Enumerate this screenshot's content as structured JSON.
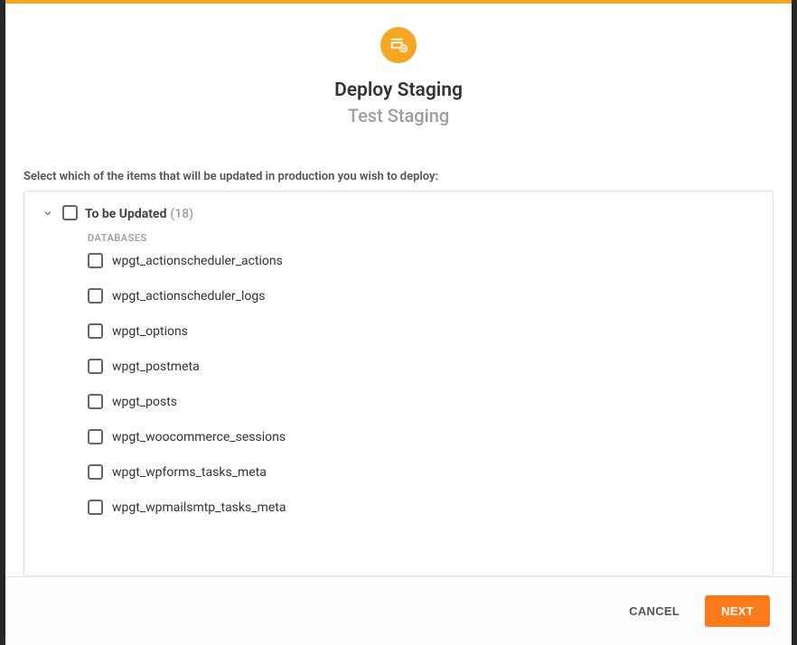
{
  "header": {
    "title": "Deploy Staging",
    "subtitle": "Test Staging"
  },
  "body": {
    "instruction": "Select which of the items that will be updated in production you wish to deploy:",
    "group": {
      "title": "To be Updated",
      "count": "(18)",
      "subgroup_label": "DATABASES",
      "items": [
        "wpgt_actionscheduler_actions",
        "wpgt_actionscheduler_logs",
        "wpgt_options",
        "wpgt_postmeta",
        "wpgt_posts",
        "wpgt_woocommerce_sessions",
        "wpgt_wpforms_tasks_meta",
        "wpgt_wpmailsmtp_tasks_meta"
      ]
    }
  },
  "footer": {
    "cancel_label": "CANCEL",
    "next_label": "NEXT"
  }
}
